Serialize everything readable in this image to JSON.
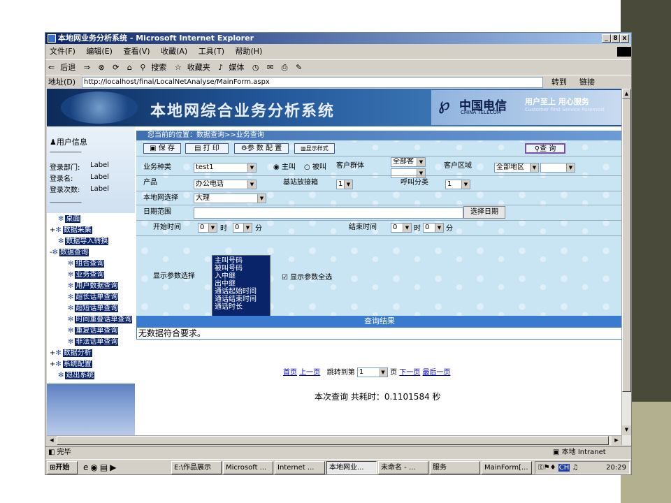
{
  "window": {
    "title": "本地网业务分析系统 - Microsoft Internet Explorer",
    "controls": [
      "_",
      "8",
      "x"
    ]
  },
  "menubar": [
    "文件(F)",
    "编辑(E)",
    "查看(V)",
    "收藏(A)",
    "工具(T)",
    "帮助(H)"
  ],
  "toolbar": {
    "back": "后退",
    "search": "搜索",
    "favorites": "收藏夹",
    "media": "媒体"
  },
  "addressbar": {
    "label": "地址(D)",
    "url": "http://localhost/final/LocalNetAnalyse/MainForm.aspx",
    "go": "转到",
    "links": "链接"
  },
  "banner": {
    "title": "本地网综合业务分析系统",
    "logo": "中国电信",
    "logo_en": "CHINA TELECOM",
    "slogan": "用户至上 用心服务",
    "slogan_en": "Customer First Service Foremost"
  },
  "userinfo": {
    "heading": "用户信息",
    "separator": "--------------------",
    "rows": [
      {
        "label": "登录部门:",
        "value": "Label"
      },
      {
        "label": "登录名:",
        "value": "Label"
      },
      {
        "label": "登录次数:",
        "value": "Label"
      }
    ]
  },
  "tree": [
    {
      "label": "桌面",
      "level": 0
    },
    {
      "label": "数据采集",
      "level": 0,
      "expander": "+"
    },
    {
      "label": "数据导入转换",
      "level": 0
    },
    {
      "label": "数据查询",
      "level": 0,
      "expander": "-"
    },
    {
      "label": "组合查询",
      "level": 1
    },
    {
      "label": "业务查询",
      "level": 1
    },
    {
      "label": "用户数据查询",
      "level": 1
    },
    {
      "label": "超长话单查询",
      "level": 1
    },
    {
      "label": "超短话单查询",
      "level": 1
    },
    {
      "label": "时间重叠话单查询",
      "level": 1
    },
    {
      "label": "重复话单查询",
      "level": 1
    },
    {
      "label": "非法话单查询",
      "level": 1
    },
    {
      "label": "数据分析",
      "level": 0,
      "expander": "+"
    },
    {
      "label": "系统配置",
      "level": 0,
      "expander": "+"
    },
    {
      "label": "退出系统",
      "level": 0
    }
  ],
  "location": "您当前的位置：数据查询>>业务查询",
  "buttons": {
    "save": "保 存",
    "print": "打 印",
    "params": "参 数 配 置",
    "style": "显示样式",
    "query": "查 询",
    "choose_date": "选择日期"
  },
  "form": {
    "biz_type_label": "业务种类",
    "biz_type_value": "test1",
    "caller": "主叫",
    "callee": "被叫",
    "customer_group_label": "客户群体",
    "customer_group_value": "全部客",
    "customer_area_label": "客户区域",
    "customer_area_value": "全部地区",
    "product_label": "产品",
    "product_value": "办公电话",
    "base_station_label": "基站放接箱",
    "base_station_value": "1",
    "call_class_label": "呼叫分类",
    "call_class_value": "1",
    "local_net_label": "本地网选择",
    "local_net_value": "大理",
    "date_range_label": "日期范围",
    "start_time_label": "开始时间",
    "end_time_label": "结束时间",
    "hour_label": "时",
    "minute_label": "分",
    "zero": "0",
    "display_params_label": "显示参数选择",
    "select_all": "显示参数全选",
    "params_list": [
      "主叫号码",
      "被叫号码",
      "入中继",
      "出中继",
      "通话起始时间",
      "通话结束时间",
      "通话时长"
    ]
  },
  "result": {
    "heading": "查询结果",
    "message": "无数据符合要求。"
  },
  "pager": {
    "first": "首页",
    "prev": "上一页",
    "jump_label": "跳转到第",
    "page_value": "1",
    "page_unit": "页",
    "next": "下一页",
    "last": "最后一页"
  },
  "timing": "本次查询  共耗时：0.1101584 秒",
  "statusbar": {
    "status": "完毕",
    "zone": "本地 Intranet"
  },
  "taskbar": {
    "start": "开始",
    "tasks": [
      "E:\\作品展示",
      "Microsoft ...",
      "Internet ...",
      "本地网业...",
      "未命名 - ...",
      "服务",
      "MainForm[..."
    ],
    "tray_lang": "CH",
    "clock": "20:29"
  },
  "colors": {
    "form_bg": "#c9e4f3",
    "selected_bg": "#0a246a",
    "accent": "#3a7bd0"
  }
}
